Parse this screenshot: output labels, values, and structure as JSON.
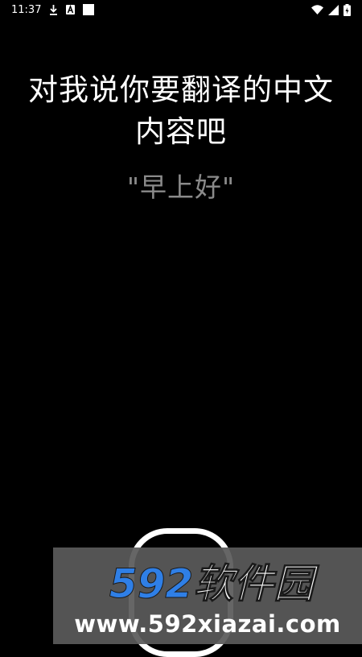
{
  "status_bar": {
    "time": "11:37",
    "left_icons": [
      "download-icon",
      "font-a-icon",
      "square-icon"
    ],
    "right_icons": [
      "wifi-icon",
      "signal-icon",
      "battery-icon"
    ]
  },
  "voice_input": {
    "prompt": "对我说你要翻译的中文内容吧",
    "recognized_text": "\"早上好\""
  },
  "watermark": {
    "logo_text": "592软件园",
    "url": "www.592xiazai.com",
    "logo_color": "#2f7fe6",
    "logo_text_color": "#ffffff"
  }
}
